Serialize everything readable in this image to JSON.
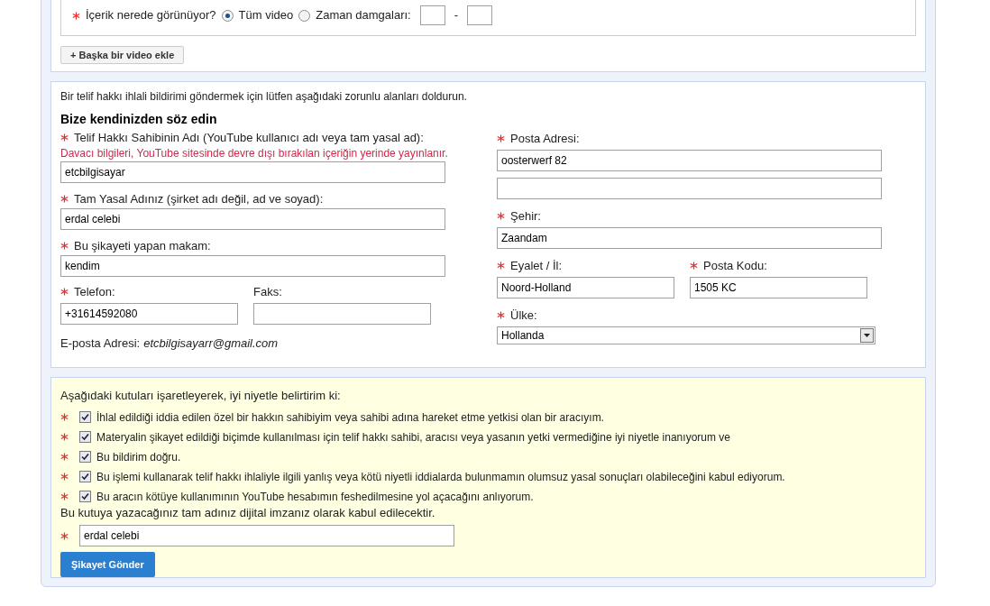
{
  "video_section": {
    "location_label": "İçerik nerede görünüyor?",
    "required": true,
    "options": [
      {
        "label": "Tüm video",
        "selected": true
      },
      {
        "label": "Zaman damgaları:",
        "selected": false
      }
    ],
    "separator": "-",
    "add_button": "+ Başka bir video ekle"
  },
  "contact_section": {
    "intro": "Bir telif hakkı ihlali bildirimi göndermek için lütfen aşağıdaki zorunlu alanları doldurun.",
    "heading": "Bize kendinizden söz edin",
    "left_fields": [
      {
        "kind": "text",
        "label": "Telif Hakkı Sahibinin Adı (YouTube kullanıcı adı veya tam yasal ad):",
        "note": "Davacı bilgileri, YouTube sitesinde devre dışı bırakılan içeriğin yerinde yayınlanır.",
        "value": "etcbilgisayar",
        "required": true
      },
      {
        "kind": "text",
        "label": "Tam Yasal Adınız (şirket adı değil, ad ve soyad):",
        "value": "erdal celebi",
        "required": true
      },
      {
        "kind": "text",
        "label": "Bu şikayeti yapan makam:",
        "value": "kendim",
        "required": true
      }
    ],
    "phone": {
      "label": "Telefon:",
      "value": "+31614592080",
      "required": true
    },
    "fax": {
      "label": "Faks:"
    },
    "email": {
      "label": "E-posta Adresi:",
      "value": "etcbilgisayarr@gmail.com"
    },
    "address": {
      "label": "Posta Adresi:",
      "value": "oosterwerf 82",
      "required": true
    },
    "city": {
      "label": "Şehir:",
      "value": "Zaandam",
      "required": true
    },
    "state": {
      "label": "Eyalet / İl:",
      "value": "Noord-Holland",
      "required": true
    },
    "postal": {
      "label": "Posta Kodu:",
      "value": "1505 KC",
      "required": true
    },
    "country": {
      "label": "Ülke:",
      "value": "Hollanda",
      "required": true
    }
  },
  "declaration_section": {
    "intro": "Aşağıdaki kutuları işaretleyerek, iyi niyetle belirtirim ki:",
    "statements": [
      {
        "text": "İhlal edildiği iddia edilen özel bir hakkın sahibiyim veya sahibi adına hareket etme yetkisi olan bir aracıyım.",
        "checked": true
      },
      {
        "text": "Materyalin şikayet edildiği biçimde kullanılması için telif hakkı sahibi, aracısı veya yasanın yetki vermediğine iyi niyetle inanıyorum ve",
        "checked": true
      },
      {
        "text": "Bu bildirim doğru.",
        "checked": true
      },
      {
        "text": "Bu işlemi kullanarak telif hakkı ihlaliyle ilgili yanlış veya kötü niyetli iddialarda bulunmamın olumsuz yasal sonuçları olabileceğini kabul ediyorum.",
        "checked": true
      },
      {
        "text": "Bu aracın kötüye kullanımının YouTube hesabımın feshedilmesine yol açacağını anlıyorum.",
        "checked": true
      }
    ],
    "signature_note": "Bu kutuya yazacağınız tam adınız dijital imzanız olarak kabul edilecektir.",
    "signature": "erdal celebi",
    "submit_button": "Şikayet Gönder"
  }
}
